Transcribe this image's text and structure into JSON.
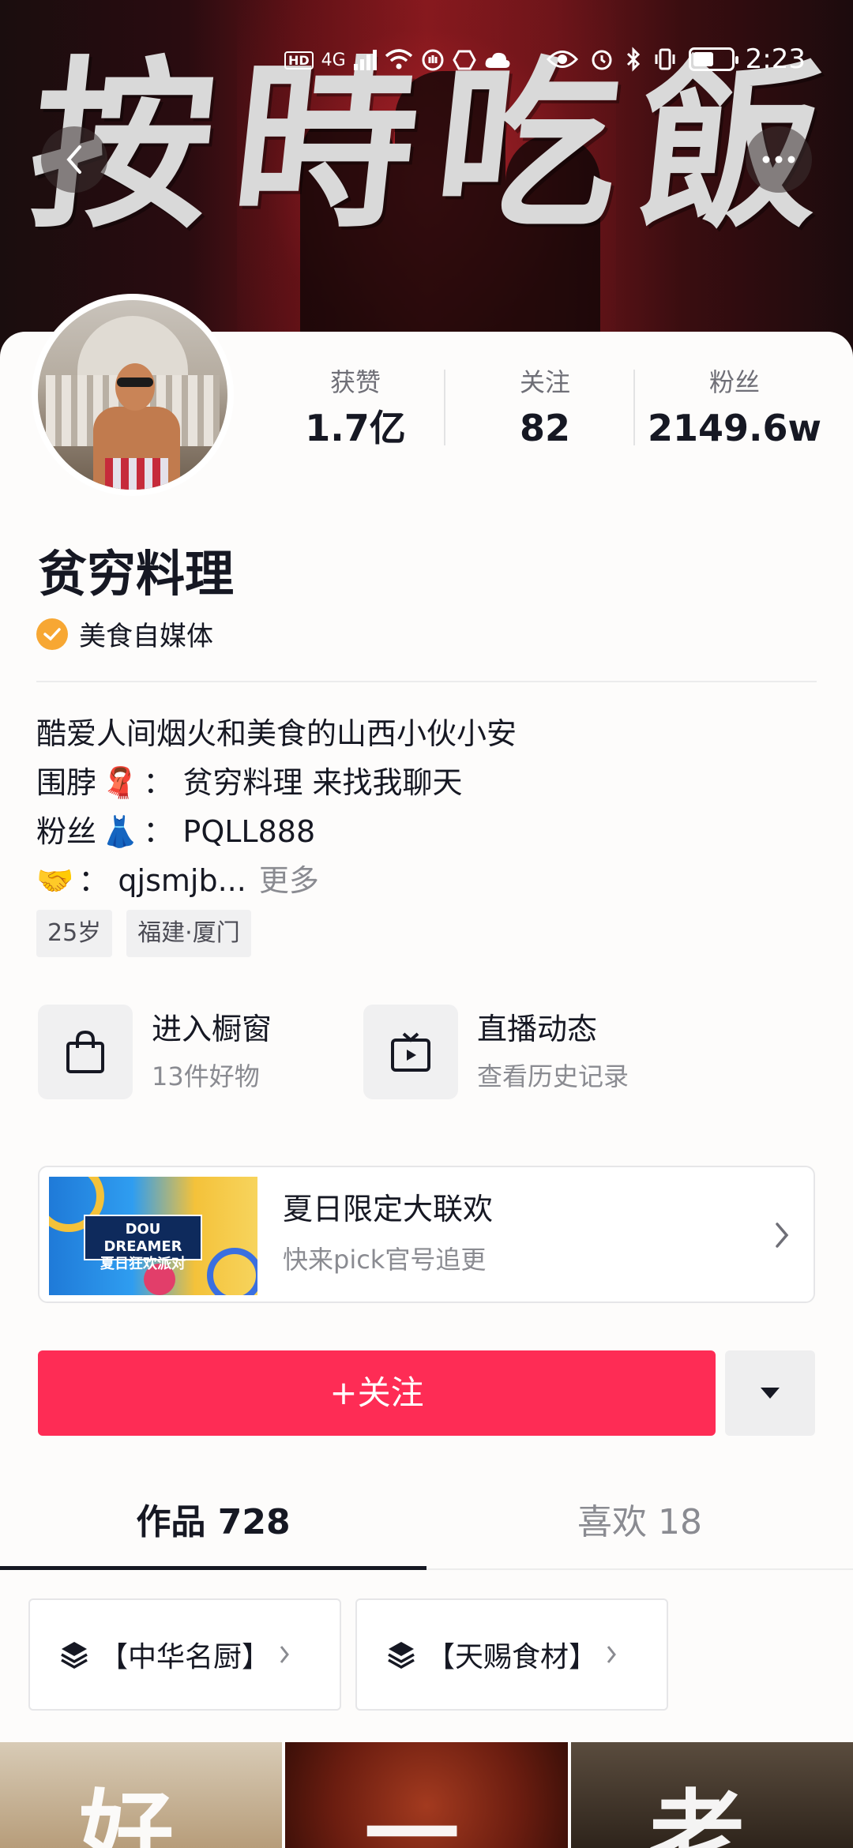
{
  "status_bar": {
    "hd": "HD",
    "network": "4G",
    "time": "2:23",
    "battery_level": 0.55
  },
  "banner": {
    "title_chars": [
      "按",
      "時",
      "吃",
      "飯"
    ]
  },
  "profile": {
    "stats": [
      {
        "label": "获赞",
        "value": "1.7亿"
      },
      {
        "label": "关注",
        "value": "82"
      },
      {
        "label": "粉丝",
        "value": "2149.6w"
      }
    ],
    "name": "贫穷料理",
    "verification": "美食自媒体",
    "bio": {
      "line1": "酷爱人间烟火和美食的山西小伙小安",
      "line2_prefix": "围脖",
      "line2_emoji": "🧣",
      "line2_text": "：  贫穷料理 来找我聊天",
      "line3_prefix": "粉丝",
      "line3_emoji": "👗",
      "line3_text": "：  PQLL888",
      "line4_emoji": "🤝",
      "line4_text": "：  qjsmjb...",
      "more": "更多"
    },
    "tags": [
      "25岁",
      "福建·厦门"
    ]
  },
  "entries": [
    {
      "title": "进入橱窗",
      "subtitle": "13件好物",
      "icon": "shopping-bag-icon"
    },
    {
      "title": "直播动态",
      "subtitle": "查看历史记录",
      "icon": "tv-icon"
    }
  ],
  "promo": {
    "image_text": "DOU DREAMER\n夏日狂欢派对",
    "title": "夏日限定大联欢",
    "subtitle": "快来pick官号追更"
  },
  "actions": {
    "follow": "+关注"
  },
  "tabs": [
    {
      "label": "作品 728",
      "active": true
    },
    {
      "label": "喜欢 18",
      "active": false
    }
  ],
  "collections": [
    {
      "label": "【中华名厨】"
    },
    {
      "label": "【天赐食材】"
    }
  ],
  "thumbnails": [
    {
      "text": "好"
    },
    {
      "text": "一"
    },
    {
      "text": "老"
    }
  ],
  "colors": {
    "accent": "#fe2c55",
    "badge": "#f7a733",
    "text": "#161823",
    "muted": "#8a8b91"
  }
}
